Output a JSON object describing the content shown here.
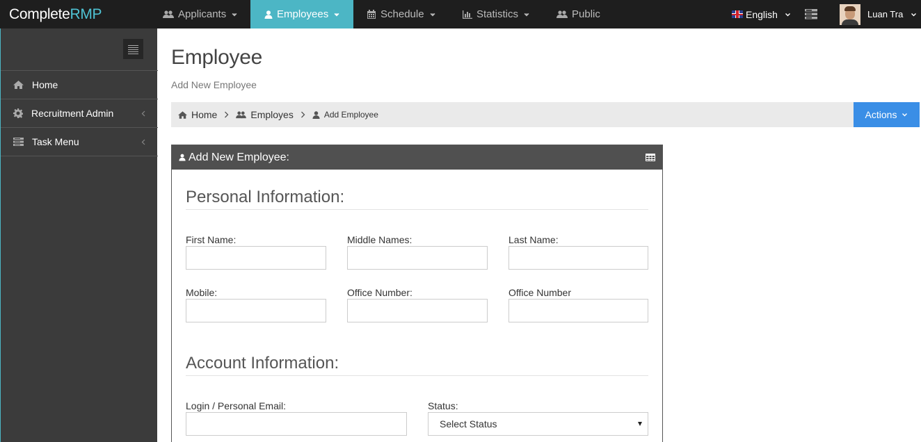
{
  "brand": {
    "prefix": "C",
    "mid": "omplete",
    "accent": "RMP"
  },
  "nav": [
    {
      "label": "Applicants"
    },
    {
      "label": "Employees"
    },
    {
      "label": "Schedule"
    },
    {
      "label": "Statistics"
    },
    {
      "label": "Public"
    }
  ],
  "language": "English",
  "user_name": "Luan Tra",
  "sidebar": {
    "items": [
      {
        "label": "Home"
      },
      {
        "label": "Recruitment Admin"
      },
      {
        "label": "Task Menu"
      }
    ]
  },
  "page": {
    "title": "Employee",
    "subtitle": "Add New Employee"
  },
  "breadcrumb": {
    "home": "Home",
    "employes": "Employes",
    "current": "Add Employee"
  },
  "actions_label": "Actions",
  "panel": {
    "title": "Add New Employee:",
    "personal_section": "Personal Information:",
    "account_section": "Account Information:",
    "fields": {
      "first_name": "First Name:",
      "middle_names": "Middle Names:",
      "last_name": "Last Name:",
      "mobile": "Mobile:",
      "office_number_1": "Office Number:",
      "office_number_2": "Office Number",
      "login_email": "Login / Personal Email:",
      "status": "Status:"
    },
    "status_selected": "Select Status"
  },
  "colors": {
    "topbar": "#1e1e1e",
    "active_nav": "#4cb6c5",
    "sidebar": "#3b3b3b",
    "actions": "#3a8ee6",
    "panel_header": "#505050"
  }
}
